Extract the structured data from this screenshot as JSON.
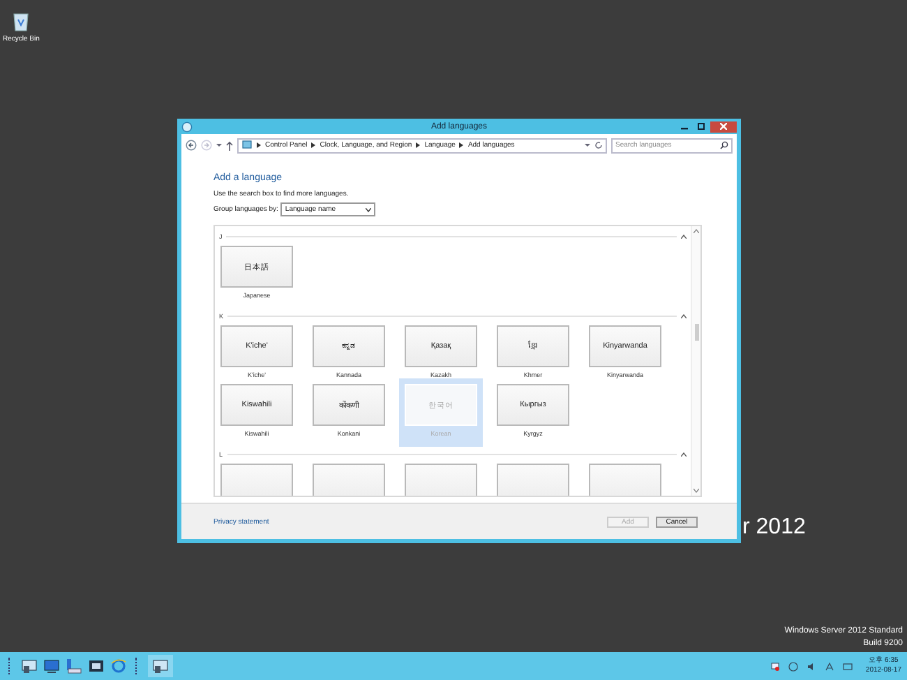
{
  "desktop": {
    "icons": [
      {
        "label": "Recycle Bin"
      }
    ],
    "background_text": "r 2012",
    "watermark": [
      "Windows Server 2012 Standard",
      "Build 9200"
    ]
  },
  "window": {
    "title": "Add languages",
    "address": {
      "crumbs": [
        "Control Panel",
        "Clock, Language, and Region",
        "Language",
        "Add languages"
      ]
    },
    "search": {
      "placeholder": "Search languages"
    },
    "heading": "Add a language",
    "hint": "Use the search box to find more languages.",
    "group_by": {
      "label": "Group languages by:",
      "value": "Language name"
    },
    "groups": [
      {
        "letter": "J",
        "languages": [
          {
            "native": "日本語",
            "name": "Japanese",
            "selected": false
          }
        ]
      },
      {
        "letter": "K",
        "languages": [
          {
            "native": "K'iche'",
            "name": "K'iche'",
            "selected": false
          },
          {
            "native": "ಕನ್ನಡ",
            "name": "Kannada",
            "selected": false
          },
          {
            "native": "Қазақ",
            "name": "Kazakh",
            "selected": false
          },
          {
            "native": "ខ្មែរ",
            "name": "Khmer",
            "selected": false
          },
          {
            "native": "Kinyarwanda",
            "name": "Kinyarwanda",
            "selected": false
          },
          {
            "native": "Kiswahili",
            "name": "Kiswahili",
            "selected": false
          },
          {
            "native": "कोंकणी",
            "name": "Konkani",
            "selected": false
          },
          {
            "native": "한국어",
            "name": "Korean",
            "selected": true
          },
          {
            "native": "Кыргыз",
            "name": "Kyrgyz",
            "selected": false
          }
        ]
      },
      {
        "letter": "L",
        "languages": [
          {
            "selected": false
          },
          {
            "selected": false
          },
          {
            "selected": false
          },
          {
            "selected": false
          },
          {
            "selected": false
          }
        ]
      }
    ],
    "privacy_link": "Privacy statement",
    "buttons": [
      {
        "label": "Add",
        "disabled": true
      },
      {
        "label": "Cancel",
        "disabled": false
      }
    ]
  },
  "taskbar": {
    "time": "오후 6:35",
    "date": "2012-08-17"
  }
}
